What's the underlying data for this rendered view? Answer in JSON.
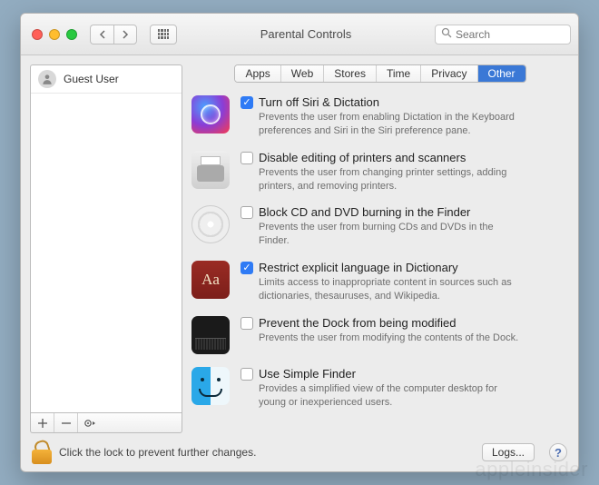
{
  "window": {
    "title": "Parental Controls"
  },
  "search": {
    "placeholder": "Search"
  },
  "sidebar": {
    "users": [
      {
        "name": "Guest User"
      }
    ],
    "footer": {
      "add": "+",
      "remove": "−",
      "gear": "✱"
    }
  },
  "tabs": [
    {
      "label": "Apps",
      "active": false
    },
    {
      "label": "Web",
      "active": false
    },
    {
      "label": "Stores",
      "active": false
    },
    {
      "label": "Time",
      "active": false
    },
    {
      "label": "Privacy",
      "active": false
    },
    {
      "label": "Other",
      "active": true
    }
  ],
  "options": [
    {
      "icon": "siri-icon",
      "checked": true,
      "title": "Turn off Siri & Dictation",
      "desc": "Prevents the user from enabling Dictation in the Keyboard preferences and Siri in the Siri preference pane."
    },
    {
      "icon": "printer-icon",
      "checked": false,
      "title": "Disable editing of printers and scanners",
      "desc": "Prevents the user from changing printer settings, adding printers, and removing printers."
    },
    {
      "icon": "cd-icon",
      "checked": false,
      "title": "Block CD and DVD burning in the Finder",
      "desc": "Prevents the user from burning CDs and DVDs in the Finder."
    },
    {
      "icon": "dictionary-icon",
      "checked": true,
      "title": "Restrict explicit language in Dictionary",
      "desc": "Limits access to inappropriate content in sources such as dictionaries, thesauruses, and Wikipedia."
    },
    {
      "icon": "dock-icon",
      "checked": false,
      "title": "Prevent the Dock from being modified",
      "desc": "Prevents the user from modifying the contents of the Dock."
    },
    {
      "icon": "finder-icon",
      "checked": false,
      "title": "Use Simple Finder",
      "desc": "Provides a simplified view of the computer desktop for young or inexperienced users."
    }
  ],
  "footer": {
    "lock_text": "Click the lock to prevent further changes.",
    "logs_label": "Logs...",
    "help_label": "?"
  },
  "watermark": "appleinsider"
}
